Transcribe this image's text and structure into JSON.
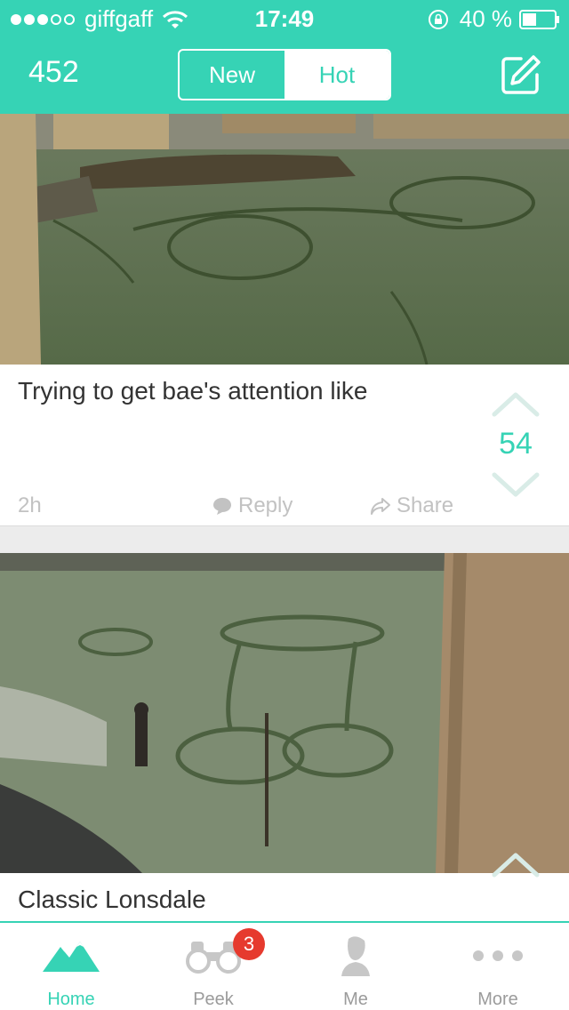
{
  "status_bar": {
    "carrier": "giffgaff",
    "time": "17:49",
    "battery": "40 %"
  },
  "header": {
    "karma": "452",
    "tabs": [
      {
        "label": "New",
        "selected": false
      },
      {
        "label": "Hot",
        "selected": true
      }
    ]
  },
  "feed": {
    "posts": [
      {
        "text": "Trying to get bae's attention like",
        "time": "2h",
        "reply_label": "Reply",
        "share_label": "Share",
        "score": "54"
      },
      {
        "text": "Classic Lonsdale"
      }
    ]
  },
  "tab_bar": {
    "items": [
      {
        "label": "Home",
        "icon": "mountain-icon",
        "active": true
      },
      {
        "label": "Peek",
        "icon": "binoculars-icon",
        "badge": "3"
      },
      {
        "label": "Me",
        "icon": "person-icon"
      },
      {
        "label": "More",
        "icon": "ellipsis-icon"
      }
    ]
  },
  "colors": {
    "brand": "#36d3b5",
    "badge": "#e63a2e"
  }
}
